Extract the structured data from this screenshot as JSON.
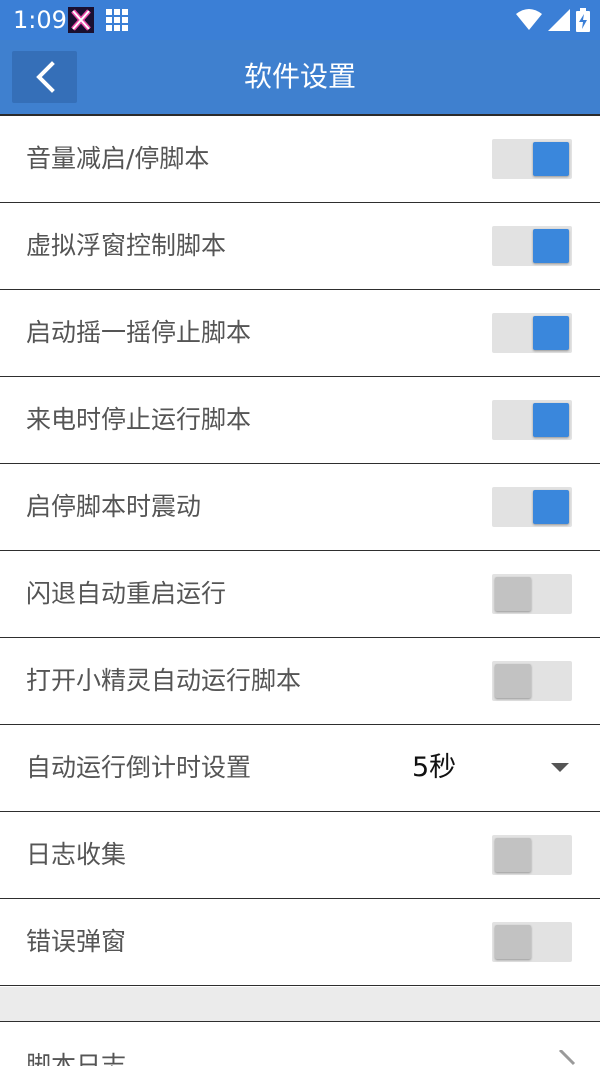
{
  "status_bar": {
    "time": "1:09",
    "icons": [
      "x-app-icon",
      "grid-app-icon",
      "wifi-icon",
      "signal-icon",
      "battery-charging-icon"
    ]
  },
  "app_bar": {
    "title": "软件设置",
    "back_icon": "chevron-left-icon"
  },
  "settings": [
    {
      "label": "音量减启/停脚本",
      "type": "switch",
      "checked": true
    },
    {
      "label": "虚拟浮窗控制脚本",
      "type": "switch",
      "checked": true
    },
    {
      "label": "启动摇一摇停止脚本",
      "type": "switch",
      "checked": true
    },
    {
      "label": "来电时停止运行脚本",
      "type": "switch",
      "checked": true
    },
    {
      "label": "启停脚本时震动",
      "type": "switch",
      "checked": true
    },
    {
      "label": "闪退自动重启运行",
      "type": "switch",
      "checked": false
    },
    {
      "label": "打开小精灵自动运行脚本",
      "type": "switch",
      "checked": false
    },
    {
      "label": "自动运行倒计时设置",
      "type": "select",
      "value": "5秒"
    },
    {
      "label": "日志收集",
      "type": "switch",
      "checked": false
    },
    {
      "label": "错误弹窗",
      "type": "switch",
      "checked": false
    }
  ],
  "log_row": {
    "label": "脚本日志",
    "icon": "chevron-right-icon"
  },
  "colors": {
    "status_bar": "#3b7fd6",
    "app_bar": "#3f80cf",
    "switch_on": "#3a87dc",
    "switch_off_knob": "#c2c2c2",
    "switch_track": "#e2e2e2"
  }
}
